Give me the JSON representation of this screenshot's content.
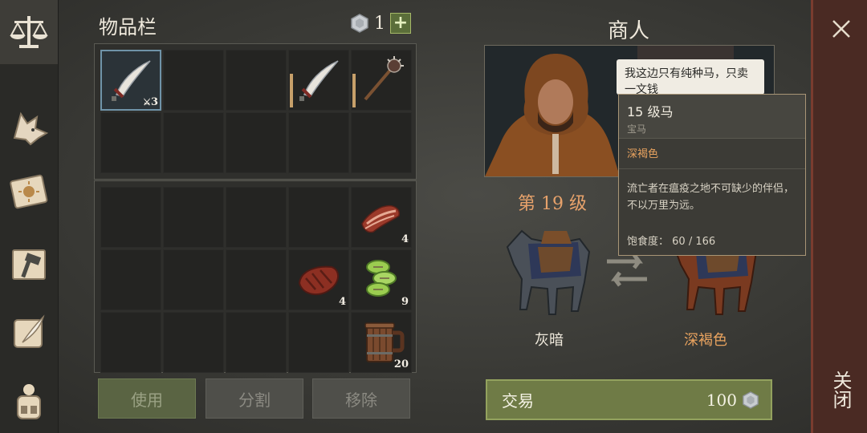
{
  "sidebar": {
    "items": [
      {
        "icon": "scales-icon",
        "active": true
      },
      {
        "icon": "wolf-head-icon"
      },
      {
        "icon": "sun-book-icon"
      },
      {
        "icon": "hammer-map-icon"
      },
      {
        "icon": "quill-scroll-icon"
      },
      {
        "icon": "backpack-icon"
      }
    ]
  },
  "inventory": {
    "title": "物品栏",
    "coins": "1",
    "plus": "+",
    "top_slots": [
      {
        "item": "curved-sword-icon",
        "qty": "3",
        "qty_icon": "dagger-icon",
        "selected": true
      },
      {
        "item": ""
      },
      {
        "item": ""
      },
      {
        "item": "curved-sword-icon"
      },
      {
        "item": "mace-icon"
      },
      {
        "item": ""
      },
      {
        "item": ""
      },
      {
        "item": ""
      },
      {
        "item": ""
      },
      {
        "item": ""
      }
    ],
    "bottom_slots": [
      {
        "item": ""
      },
      {
        "item": ""
      },
      {
        "item": ""
      },
      {
        "item": ""
      },
      {
        "item": "bacon-icon",
        "qty": "4"
      },
      {
        "item": ""
      },
      {
        "item": ""
      },
      {
        "item": ""
      },
      {
        "item": "steak-icon",
        "qty": "4"
      },
      {
        "item": "cucumber-slices-icon",
        "qty": "9"
      },
      {
        "item": ""
      },
      {
        "item": ""
      },
      {
        "item": ""
      },
      {
        "item": ""
      },
      {
        "item": "wooden-mug-icon",
        "qty": "20"
      }
    ],
    "buttons": {
      "use": "使用",
      "split": "分割",
      "remove": "移除"
    }
  },
  "merchant": {
    "title": "商人",
    "speech": "我这边只有纯种马，只卖一文钱",
    "level": "第 19 级",
    "horse_left": "灰暗",
    "horse_right": "深褐色",
    "trade_label": "交易",
    "trade_price": "100"
  },
  "tooltip": {
    "name": "15 级马",
    "subtitle": "宝马",
    "color": "深褐色",
    "description": "流亡者在瘟疫之地不可缺少的伴侣，不以万里为远。",
    "satiety_label": "饱食度：",
    "satiety_value": "60 / 166"
  },
  "close": {
    "text": "关闭"
  },
  "colors": {
    "accent_green": "#6f7b46",
    "orange_text": "#e9a35f",
    "close_bg": "#4a2a23"
  }
}
